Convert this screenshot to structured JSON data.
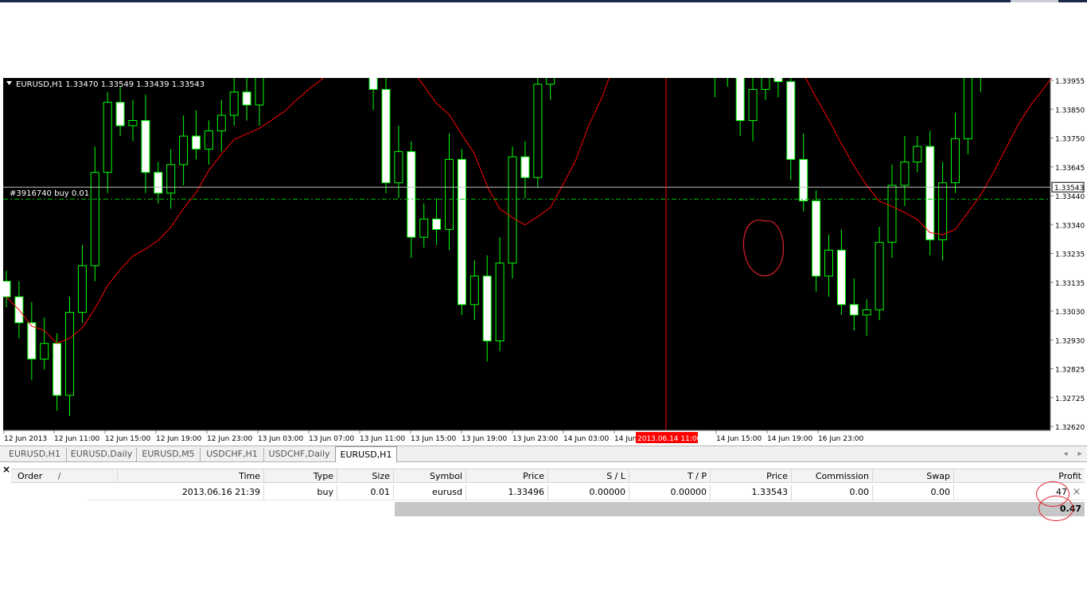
{
  "chart": {
    "symbol_header": "EURUSD,H1  1.33470 1.33549 1.33439 1.33543",
    "order_line_label": "#3916740 buy 0.01",
    "current_price_tag": "1.33543",
    "price_axis_labels": [
      "1.33955",
      "1.33850",
      "1.33750",
      "1.33645",
      "1.33440",
      "1.33340",
      "1.33235",
      "1.33135",
      "1.33030",
      "1.32930",
      "1.32825",
      "1.32725",
      "1.32620"
    ],
    "time_axis_labels": [
      "12 Jun 2013",
      "12 Jun 11:00",
      "12 Jun 15:00",
      "12 Jun 19:00",
      "12 Jun 23:00",
      "13 Jun 03:00",
      "13 Jun 07:00",
      "13 Jun 11:00",
      "13 Jun 15:00",
      "13 Jun 19:00",
      "13 Jun 23:00",
      "14 Jun 03:00",
      "14 Jun 07:00",
      "14 Jun 15:00",
      "14 Jun 19:00",
      "16 Jun 23:00"
    ],
    "crosshair_time_label": "2013.06.14 11:00",
    "colors": {
      "background": "#000000",
      "bull_candle": "#000000",
      "bear_candle": "#ffffff",
      "wick": "#00ff00",
      "moving_average": "#ff0000",
      "order_line": "#00c000",
      "crosshair": "#ff0000",
      "price_line": "#c0c0c0"
    }
  },
  "chart_tabs": [
    "EURUSD,H1",
    "EURUSD,Daily",
    "EURUSD,M5",
    "USDCHF,H1",
    "USDCHF,Daily",
    "EURUSD,H1"
  ],
  "active_tab_index": 5,
  "terminal": {
    "close_glyph": "×",
    "columns": [
      "Order",
      "Time",
      "Type",
      "Size",
      "Symbol",
      "Price",
      "S / L",
      "T / P",
      "Price",
      "Commission",
      "Swap",
      "Profit"
    ],
    "sort_indicator": "/",
    "row": {
      "time": "2013.06.16 21:39",
      "type": "buy",
      "size": "0.01",
      "symbol": "eurusd",
      "open_price": "1.33496",
      "sl": "0.00000",
      "tp": "0.00000",
      "current_price": "1.33543",
      "commission": "0.00",
      "swap": "0.00",
      "profit": "47"
    },
    "summary_profit": "0.47"
  },
  "icons": {
    "header_triangle": "dropdown-triangle-icon",
    "tab_left": "◂",
    "tab_right": "▸",
    "row_close": "×"
  }
}
